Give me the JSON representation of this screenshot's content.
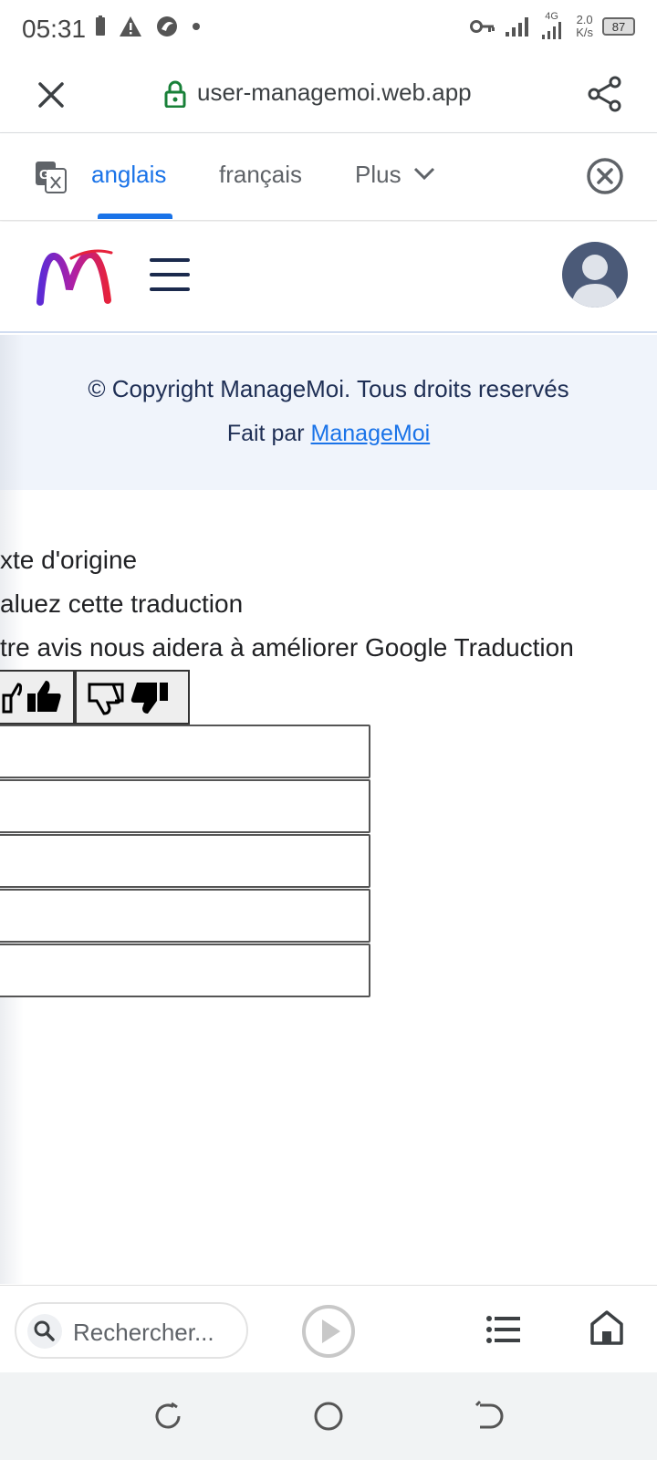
{
  "status_bar": {
    "time": "05:31",
    "network_label": "4G",
    "speed_value": "2.0",
    "speed_unit": "K/s",
    "battery": "87"
  },
  "url_bar": {
    "url": "user-managemoi.web.app"
  },
  "translate_bar": {
    "tabs": [
      {
        "label": "anglais",
        "active": true
      },
      {
        "label": "français",
        "active": false
      },
      {
        "label": "Plus",
        "active": false
      }
    ]
  },
  "page": {
    "copyright": "© Copyright ManageMoi. Tous droits reservés",
    "made_by_prefix": "Fait par ",
    "made_by_link": "ManageMoi"
  },
  "translate_widget": {
    "original_text": "xte d'origine",
    "rate_prompt": "aluez cette traduction",
    "feedback_note": "tre avis nous aidera à améliorer Google Traduction"
  },
  "bottom_bar": {
    "search_placeholder": "Rechercher..."
  },
  "colors": {
    "accent": "#1a73e8",
    "band": "#f0f4fb",
    "text_dark": "#1f2f55"
  },
  "icons": [
    "close-icon",
    "lock-icon",
    "share-icon",
    "google-translate-icon",
    "chevron-down-icon",
    "close-circle-icon",
    "hamburger-icon",
    "user-avatar-icon",
    "thumbs-up-icon",
    "thumbs-down-icon",
    "search-icon",
    "play-icon",
    "list-icon",
    "home-icon"
  ]
}
